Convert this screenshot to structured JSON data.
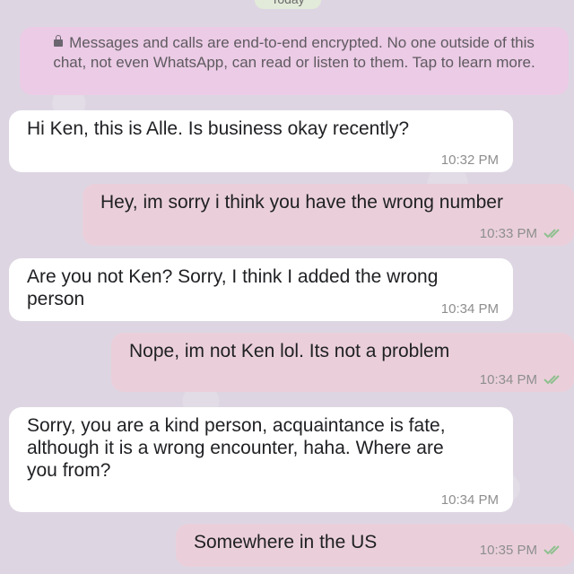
{
  "chat": {
    "date_label": "Today",
    "encryption_notice": "Messages and calls are end-to-end encrypted. No one outside of this chat, not even WhatsApp, can read or listen to them. Tap to learn more."
  },
  "messages": [
    {
      "direction": "incoming",
      "text": "Hi Ken, this is Alle. Is business okay recently?",
      "time": "10:32 PM"
    },
    {
      "direction": "outgoing",
      "text": "Hey, im sorry i think you have the wrong number",
      "time": "10:33 PM",
      "status": "read"
    },
    {
      "direction": "incoming",
      "text": "Are you not Ken? Sorry, I think I added the wrong person",
      "time": "10:34 PM"
    },
    {
      "direction": "outgoing",
      "text": "Nope, im not Ken lol. Its not a problem",
      "time": "10:34 PM",
      "status": "read"
    },
    {
      "direction": "incoming",
      "text": "Sorry, you are a kind person, acquaintance is fate, although it is a wrong encounter, haha. Where are you from?",
      "time": "10:34 PM"
    },
    {
      "direction": "outgoing",
      "text": "Somewhere in the US",
      "time": "10:35 PM",
      "status": "read"
    }
  ],
  "colors": {
    "background": "#ddd6e2",
    "incoming_bubble": "#ffffff",
    "outgoing_bubble": "#eacfda",
    "system_note": "#ebcbe5",
    "read_check": "#8fbf8f"
  }
}
